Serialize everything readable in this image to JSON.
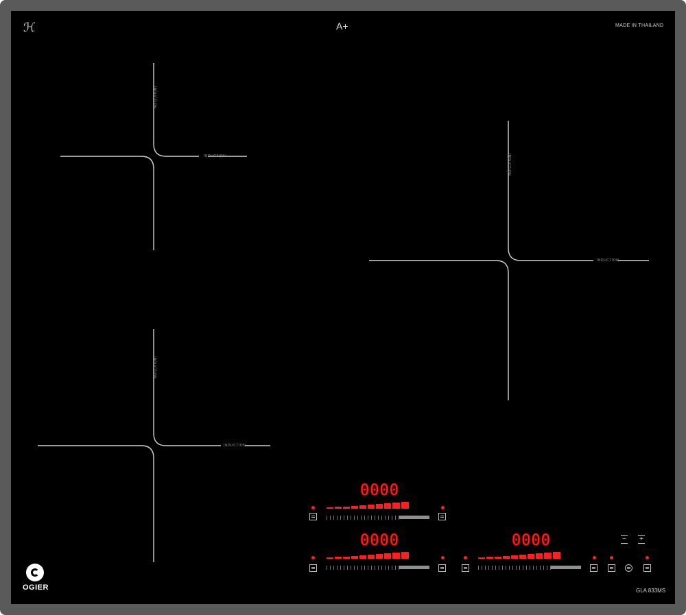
{
  "header": {
    "brand_mark": "ℋ",
    "energy_class": "A+",
    "origin": "MADE IN THAILAND"
  },
  "footer": {
    "logo_text": "OGIER",
    "model": "GLA 833MS"
  },
  "cooking_zones": [
    {
      "id": "zone-top-left",
      "label": "INDUCTION",
      "vertical_label": "INDUCTION"
    },
    {
      "id": "zone-right",
      "label": "INDUCTION",
      "vertical_label": "INDUCTION"
    },
    {
      "id": "zone-bottom-left",
      "label": "INDUCTION",
      "vertical_label": "INDUCTION"
    }
  ],
  "controls": {
    "displays": [
      "0000",
      "0000",
      "0000"
    ],
    "minus_label": "−",
    "plus_label": "+",
    "power_levels": 9,
    "colors": {
      "indicator": "#ff2020",
      "glass": "#000000",
      "frame": "#5a5a5a",
      "line": "#d0d0d0"
    },
    "icons": [
      "timer-icon",
      "boost-icon",
      "keep-warm-icon",
      "lock-icon",
      "power-icon",
      "pause-icon"
    ]
  }
}
